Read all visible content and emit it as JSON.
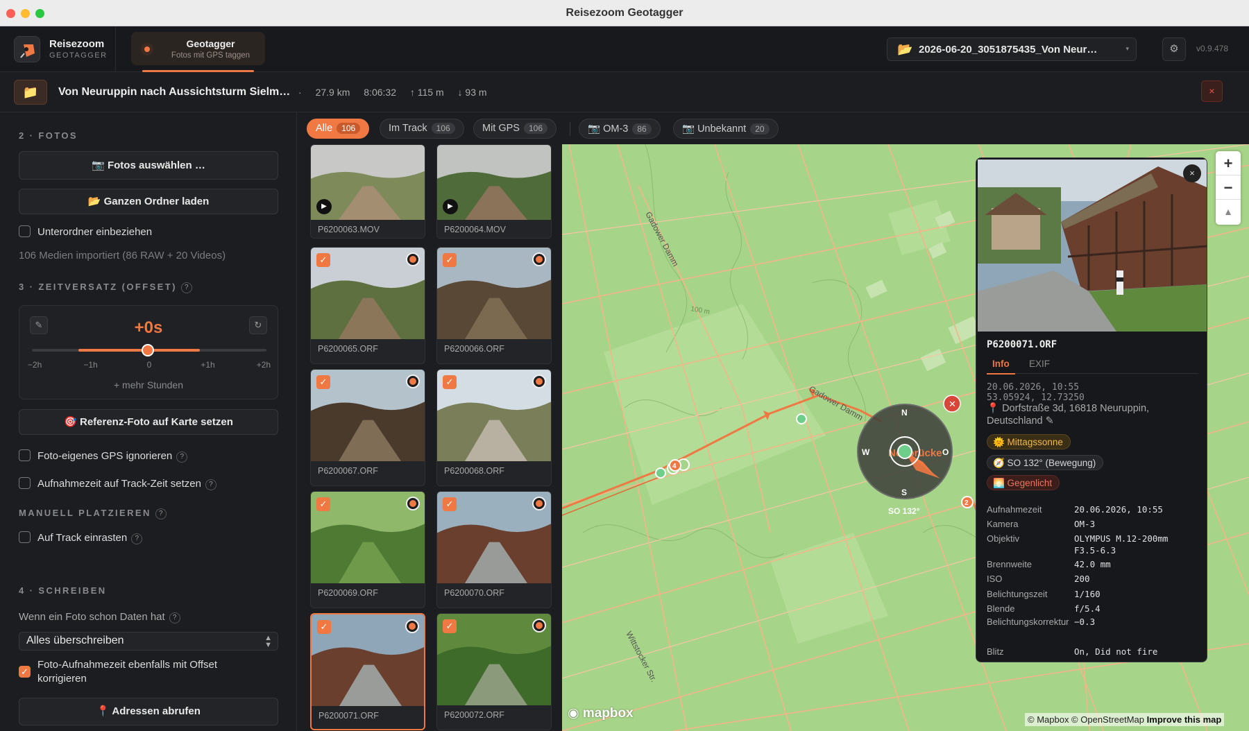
{
  "window": {
    "title": "Reisezoom Geotagger"
  },
  "header": {
    "brand": "Reisezoom",
    "brand_sub": "GEOTAGGER",
    "nav_tab_title": "Geotagger",
    "nav_tab_sub": "Fotos mit GPS taggen",
    "file_select": "2026-06-20_3051875435_Von Neur…",
    "settings_icon": "gear-icon",
    "version": "v0.9.478"
  },
  "track": {
    "title": "Von Neuruppin nach Aussichtsturm Sielm…",
    "separator": "·",
    "distance": "27.9 km",
    "duration": "8:06:32",
    "ascent": "↑ 115 m",
    "descent": "↓ 93 m",
    "close": "×"
  },
  "sidebar": {
    "photos_section": "2 · FOTOS",
    "select_photos": "📷 Fotos auswählen …",
    "load_folder": "📂 Ganzen Ordner laden",
    "include_subfolders": "Unterordner einbeziehen",
    "import_status": "106 Medien importiert (86 RAW + 20 Videos)",
    "offset_section": "3 · ZEITVERSATZ (OFFSET)",
    "help": "?",
    "offset_value": "+0s",
    "offset_fraction": 0.5,
    "ticks": [
      "−2h",
      "−1h",
      "0",
      "+1h",
      "+2h"
    ],
    "more_hours": "+ mehr Stunden",
    "reference_photo": "🎯 Referenz-Foto auf Karte setzen",
    "ignore_gps": "Foto-eigenes GPS ignorieren",
    "set_track_time": "Aufnahmezeit auf Track-Zeit setzen",
    "manual_section": "MANUELL PLATZIEREN",
    "snap_track": "Auf Track einrasten",
    "write_section": "4 · SCHREIBEN",
    "existing_data_label": "Wenn ein Foto schon Daten hat",
    "existing_data_value": "Alles überschreiben",
    "correct_time_line1": "Foto-Aufnahmezeit ebenfalls mit Offset",
    "correct_time_line2": "korrigieren",
    "fetch_addresses": "📍 Adressen abrufen"
  },
  "filters": [
    {
      "label": "Alle",
      "count": "106",
      "active": true
    },
    {
      "label": "Im Track",
      "count": "106",
      "active": false
    },
    {
      "label": "Mit GPS",
      "count": "106",
      "active": false
    },
    {
      "label": "📷 OM-3",
      "count": "86",
      "active": false
    },
    {
      "label": "📷 Unbekannt",
      "count": "20",
      "active": false
    }
  ],
  "photos": [
    {
      "name": "P6200063.MOV",
      "video": true,
      "checked": false
    },
    {
      "name": "P6200064.MOV",
      "video": true,
      "checked": false
    },
    {
      "name": "P6200065.ORF",
      "video": false,
      "checked": true
    },
    {
      "name": "P6200066.ORF",
      "video": false,
      "checked": true
    },
    {
      "name": "P6200067.ORF",
      "video": false,
      "checked": true
    },
    {
      "name": "P6200068.ORF",
      "video": false,
      "checked": true
    },
    {
      "name": "P6200069.ORF",
      "video": false,
      "checked": true
    },
    {
      "name": "P6200070.ORF",
      "video": false,
      "checked": true
    },
    {
      "name": "P6200071.ORF",
      "video": false,
      "checked": true,
      "selected": true
    },
    {
      "name": "P6200072.ORF",
      "video": false,
      "checked": true
    }
  ],
  "map": {
    "labels": {
      "road1": "Gadower Damm",
      "road2": "Gadower Damm",
      "road3": "Wittstocker Str.",
      "contour": "100 m",
      "place": "Neubrücke"
    },
    "compass": {
      "n": "N",
      "s": "S",
      "w": "W",
      "o": "O",
      "heading_label": "SO 132°"
    },
    "markers": [
      "4",
      "2"
    ],
    "zoom_in": "+",
    "zoom_out": "−",
    "north": "▲",
    "attribution": "© Mapbox © OpenStreetMap",
    "improve": "Improve this map",
    "logo": "mapbox",
    "close": "✕"
  },
  "popup": {
    "close": "×",
    "file": "P6200071.ORF",
    "tab_info": "Info",
    "tab_exif": "EXIF",
    "datetime": "20.06.2026, 10:55",
    "coords": "53.05924, 12.73250",
    "address_line1": "📍 Dorfstraße 3d, 16818 Neuruppin,",
    "address_line2": "Deutschland ✎",
    "chip_sun": "🌞 Mittagssonne",
    "chip_dir": "🧭 SO 132° (Bewegung)",
    "chip_light": "🌅 Gegenlicht",
    "exif": [
      {
        "k": "Aufnahmezeit",
        "v": "20.06.2026, 10:55"
      },
      {
        "k": "Kamera",
        "v": "OM-3"
      },
      {
        "k": "Objektiv",
        "v": "OLYMPUS M.12-200mm F3.5-6.3"
      },
      {
        "k": "Brennweite",
        "v": "42.0 mm"
      },
      {
        "k": "ISO",
        "v": "200"
      },
      {
        "k": "Belichtungszeit",
        "v": "1/160"
      },
      {
        "k": "Blende",
        "v": "f/5.4"
      },
      {
        "k": "Belichtungskorrektur",
        "v": "−0.3"
      },
      {
        "k": "Blitz",
        "v": "On, Did not fire"
      }
    ]
  },
  "colors": {
    "accent": "#ef7843",
    "map_bg": "#a9d58b",
    "track": "#ef7843"
  }
}
